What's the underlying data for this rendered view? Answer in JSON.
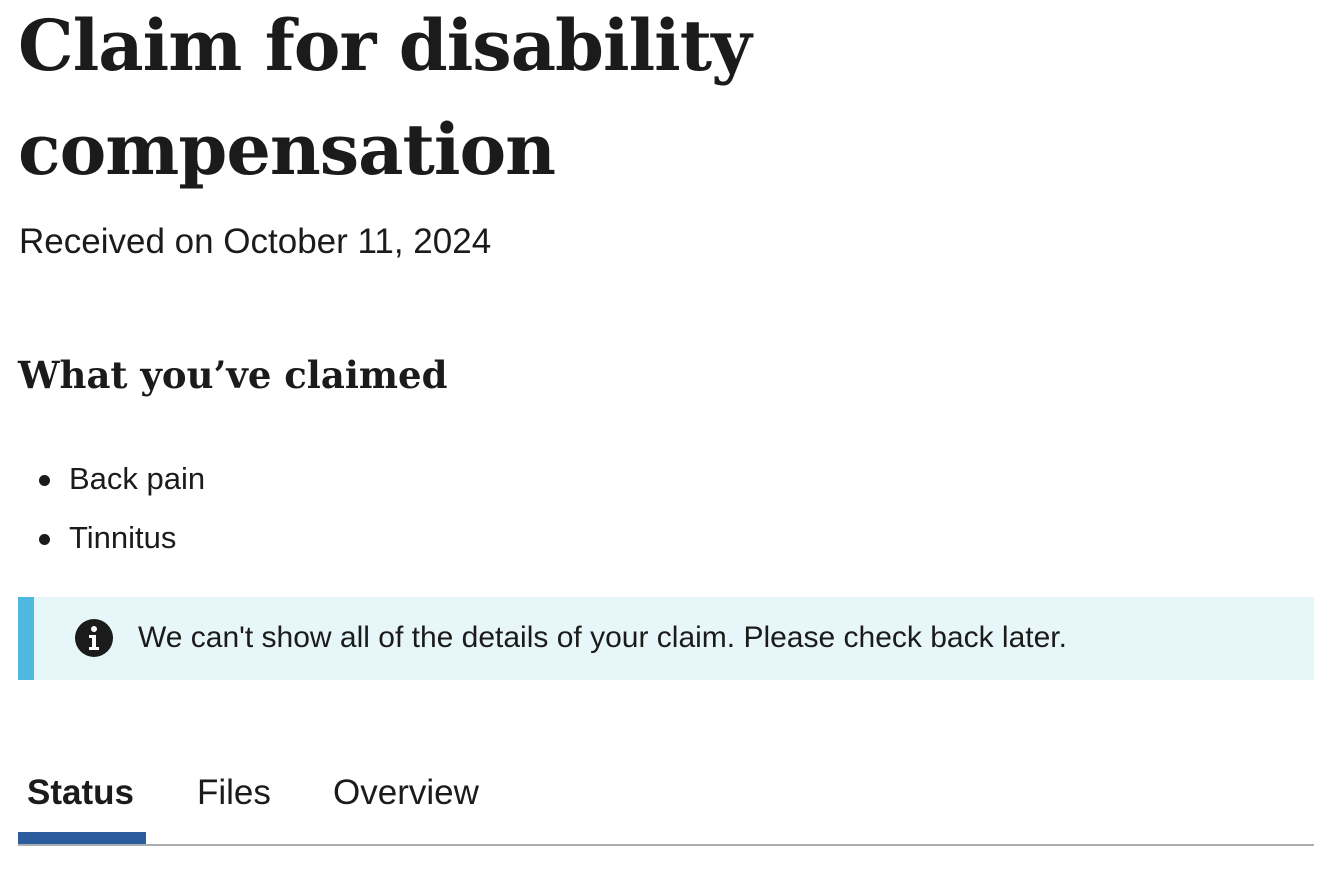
{
  "page": {
    "title": "Claim for disability compensation",
    "received": "Received on October 11, 2024"
  },
  "claimed": {
    "heading": "What you’ve claimed",
    "items": [
      {
        "label": "Back pain"
      },
      {
        "label": "Tinnitus"
      }
    ]
  },
  "alert": {
    "icon": "info-icon",
    "message": "We can't show all of the details of your claim. Please check back later.",
    "background_color": "#e7f6f8",
    "border_color": "#4fb8e0"
  },
  "tabs": {
    "active": "Status",
    "indicator_color": "#2a5c9e",
    "items": [
      {
        "label": "Status"
      },
      {
        "label": "Files"
      },
      {
        "label": "Overview"
      }
    ]
  }
}
